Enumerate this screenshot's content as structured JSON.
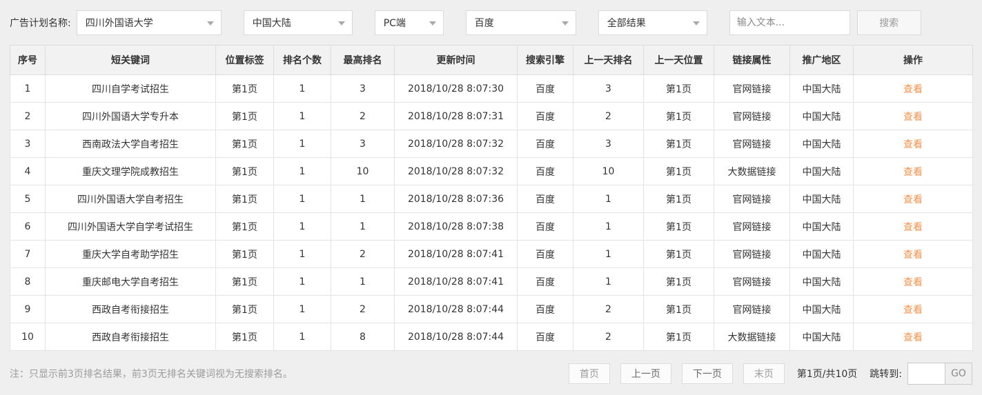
{
  "colors": {
    "accent_link": "#ED9352",
    "page_bg": "#efefef",
    "header_bg": "#f2f2f2",
    "border": "#dcdcdc"
  },
  "filters": {
    "label": "广告计划名称:",
    "plan_selected": "四川外国语大学",
    "region_selected": "中国大陆",
    "device_selected": "PC端",
    "engine_selected": "百度",
    "result_selected": "全部结果",
    "search_placeholder": "输入文本...",
    "search_button": "搜索"
  },
  "table": {
    "columns": [
      "序号",
      "短关键词",
      "位置标签",
      "排名个数",
      "最高排名",
      "更新时间",
      "搜索引擎",
      "上一天排名",
      "上一天位置",
      "链接属性",
      "推广地区",
      "操作"
    ],
    "action_label": "查看",
    "rows": [
      [
        "1",
        "四川自学考试招生",
        "第1页",
        "1",
        "3",
        "2018/10/28 8:07:30",
        "百度",
        "3",
        "第1页",
        "官网链接",
        "中国大陆"
      ],
      [
        "2",
        "四川外国语大学专升本",
        "第1页",
        "1",
        "2",
        "2018/10/28 8:07:31",
        "百度",
        "2",
        "第1页",
        "官网链接",
        "中国大陆"
      ],
      [
        "3",
        "西南政法大学自考招生",
        "第1页",
        "1",
        "3",
        "2018/10/28 8:07:32",
        "百度",
        "3",
        "第1页",
        "官网链接",
        "中国大陆"
      ],
      [
        "4",
        "重庆文理学院成教招生",
        "第1页",
        "1",
        "10",
        "2018/10/28 8:07:32",
        "百度",
        "10",
        "第1页",
        "大数据链接",
        "中国大陆"
      ],
      [
        "5",
        "四川外国语大学自考招生",
        "第1页",
        "1",
        "1",
        "2018/10/28 8:07:36",
        "百度",
        "1",
        "第1页",
        "官网链接",
        "中国大陆"
      ],
      [
        "6",
        "四川外国语大学自学考试招生",
        "第1页",
        "1",
        "1",
        "2018/10/28 8:07:38",
        "百度",
        "1",
        "第1页",
        "官网链接",
        "中国大陆"
      ],
      [
        "7",
        "重庆大学自考助学招生",
        "第1页",
        "1",
        "2",
        "2018/10/28 8:07:41",
        "百度",
        "1",
        "第1页",
        "官网链接",
        "中国大陆"
      ],
      [
        "8",
        "重庆邮电大学自考招生",
        "第1页",
        "1",
        "1",
        "2018/10/28 8:07:41",
        "百度",
        "1",
        "第1页",
        "官网链接",
        "中国大陆"
      ],
      [
        "9",
        "西政自考衔接招生",
        "第1页",
        "1",
        "2",
        "2018/10/28 8:07:44",
        "百度",
        "2",
        "第1页",
        "官网链接",
        "中国大陆"
      ],
      [
        "10",
        "西政自考衔接招生",
        "第1页",
        "1",
        "8",
        "2018/10/28 8:07:44",
        "百度",
        "2",
        "第1页",
        "大数据链接",
        "中国大陆"
      ]
    ]
  },
  "footer": {
    "note": "注：只显示前3页排名结果，前3页无排名关键词视为无搜索排名。",
    "pagination": {
      "first": "首页",
      "prev": "上一页",
      "next": "下一页",
      "last": "末页",
      "page_info": "第1页/共10页",
      "jump_label": "跳转到:",
      "go": "GO"
    }
  }
}
